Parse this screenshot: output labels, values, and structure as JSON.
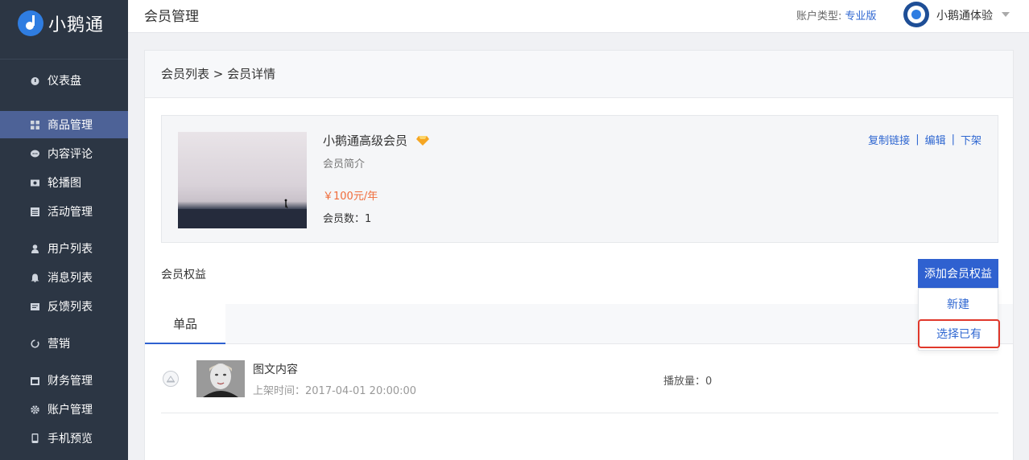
{
  "app": {
    "logo_text": "小鹅通"
  },
  "sidebar": {
    "items": [
      {
        "label": "仪表盘",
        "icon": "dashboard-icon"
      },
      {
        "label": "商品管理",
        "icon": "grid-icon",
        "active": true
      },
      {
        "label": "内容评论",
        "icon": "comment-icon"
      },
      {
        "label": "轮播图",
        "icon": "image-icon"
      },
      {
        "label": "活动管理",
        "icon": "calendar-icon"
      },
      {
        "label": "用户列表",
        "icon": "user-icon"
      },
      {
        "label": "消息列表",
        "icon": "bell-icon"
      },
      {
        "label": "反馈列表",
        "icon": "message-icon"
      },
      {
        "label": "营销",
        "icon": "refresh-icon"
      },
      {
        "label": "财务管理",
        "icon": "wallet-icon"
      },
      {
        "label": "账户管理",
        "icon": "gear-icon"
      },
      {
        "label": "手机预览",
        "icon": "phone-icon"
      }
    ]
  },
  "header": {
    "title": "会员管理",
    "account_type_label": "账户类型:",
    "account_type_value": "专业版",
    "user_name": "小鹅通体验"
  },
  "breadcrumb": "会员列表 > 会员详情",
  "member": {
    "name": "小鹅通高级会员",
    "desc": "会员简介",
    "price": "￥100元/年",
    "count": "会员数：1",
    "actions": {
      "copy": "复制链接",
      "edit": "编辑",
      "off": "下架",
      "sep": "|"
    }
  },
  "benefits": {
    "label": "会员权益",
    "add_button": "添加会员权益",
    "dropdown": {
      "new": "新建",
      "select": "选择已有"
    }
  },
  "tabs": {
    "active": "单品"
  },
  "items": [
    {
      "title": "图文内容",
      "time": "上架时间：2017-04-01 20:00:00",
      "plays": "播放量：0"
    }
  ],
  "colors": {
    "accent": "#2f61d0",
    "sidebar_bg": "#2c3644",
    "sidebar_active": "#4d6297",
    "price": "#f06c3a",
    "highlight": "#e0382b"
  }
}
